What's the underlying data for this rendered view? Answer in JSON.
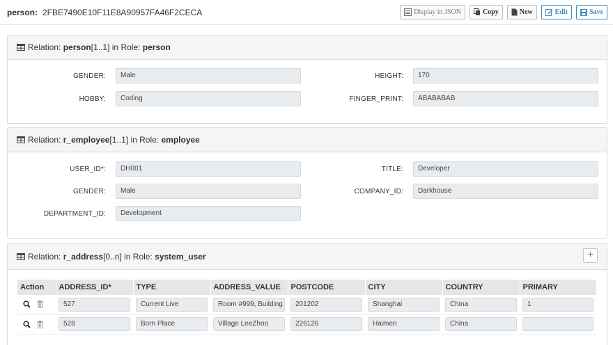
{
  "header": {
    "object_label": "person:",
    "object_id": "2FBE7490E10F11E8A90957FA46F2CECA",
    "buttons": {
      "display_json": "Display in JSON",
      "copy": "Copy",
      "new": "New",
      "edit": "Edit",
      "save": "Save"
    }
  },
  "relations": [
    {
      "prefix": "Relation:",
      "name": "person",
      "card": "[1..1]",
      "in_role": "in Role:",
      "role": "person"
    },
    {
      "prefix": "Relation:",
      "name": "r_employee",
      "card": "[1..1]",
      "in_role": "in Role:",
      "role": "employee"
    },
    {
      "prefix": "Relation:",
      "name": "r_address",
      "card": "[0..n]",
      "in_role": "in Role:",
      "role": "system_user"
    }
  ],
  "person_fields": {
    "gender": {
      "label": "GENDER:",
      "value": "Male"
    },
    "height": {
      "label": "HEIGHT:",
      "value": "170"
    },
    "hobby": {
      "label": "HOBBY:",
      "value": "Coding"
    },
    "finger_print": {
      "label": "FINGER_PRINT:",
      "value": "ABABABAB"
    }
  },
  "employee_fields": {
    "user_id": {
      "label": "USER_ID*:",
      "value": "DH001"
    },
    "title": {
      "label": "TITLE:",
      "value": "Developer"
    },
    "gender": {
      "label": "GENDER:",
      "value": "Male"
    },
    "company_id": {
      "label": "COMPANY_ID:",
      "value": "Darkhouse"
    },
    "department_id": {
      "label": "DEPARTMENT_ID:",
      "value": "Development"
    }
  },
  "address_table": {
    "columns": [
      "Action",
      "ADDRESS_ID*",
      "TYPE",
      "ADDRESS_VALUE",
      "POSTCODE",
      "CITY",
      "COUNTRY",
      "PRIMARY"
    ],
    "rows": [
      {
        "address_id": "527",
        "type": "Current Live",
        "address_value": "Room #999, Building",
        "postcode": "201202",
        "city": "Shanghai",
        "country": "China",
        "primary": "1"
      },
      {
        "address_id": "528",
        "type": "Born Place",
        "address_value": "Village LeeZhoo",
        "postcode": "226126",
        "city": "Haimen",
        "country": "China",
        "primary": ""
      }
    ]
  },
  "add_button": "+",
  "colors": {
    "accent": "#3c8dbc",
    "input_bg": "#e9ecef",
    "panel_head_bg": "#f5f5f5"
  }
}
